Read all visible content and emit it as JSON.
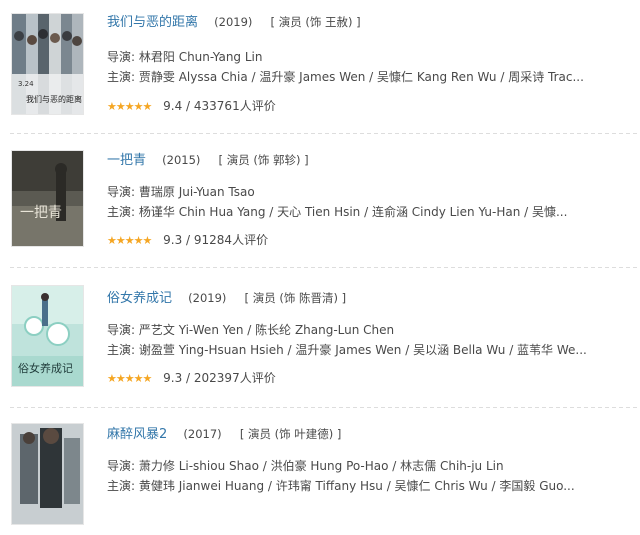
{
  "movies": [
    {
      "title": "我们与恶的距离",
      "year": "(2019)",
      "role": "[ 演员 (饰 王赦) ]",
      "director_label": "导演:",
      "director": "林君阳 Chun-Yang Lin",
      "cast_label": "主演:",
      "cast": "贾静雯 Alyssa Chia / 温升豪 James Wen / 吴慷仁 Kang Ren Wu / 周采诗 Trac...",
      "stars": "★★★★★",
      "rating": "9.4 / 433761人评价",
      "poster_icon": "movie-poster",
      "poster_text": [
        "3.24",
        "我们与恶的距离"
      ]
    },
    {
      "title": "一把青",
      "year": "(2015)",
      "role": "[ 演员 (饰 郭轸) ]",
      "director_label": "导演:",
      "director": "曹瑞原 Jui-Yuan Tsao",
      "cast_label": "主演:",
      "cast": "杨谨华 Chin Hua Yang / 天心 Tien Hsin / 连俞涵 Cindy Lien Yu-Han / 吴慷...",
      "stars": "★★★★★",
      "rating": "9.3 / 91284人评价",
      "poster_icon": "movie-poster",
      "poster_text": [
        "一把青"
      ]
    },
    {
      "title": "俗女养成记",
      "year": "(2019)",
      "role": "[ 演员 (饰 陈晋清) ]",
      "director_label": "导演:",
      "director": "严艺文 Yi-Wen Yen / 陈长纶 Zhang-Lun Chen",
      "cast_label": "主演:",
      "cast": "谢盈萱 Ying-Hsuan Hsieh / 温升豪 James Wen / 吴以涵 Bella Wu / 蓝苇华 We...",
      "stars": "★★★★★",
      "rating": "9.3 / 202397人评价",
      "poster_icon": "movie-poster",
      "poster_text": [
        "俗女养成记"
      ]
    },
    {
      "title": "麻醉风暴2",
      "year": "(2017)",
      "role": "[ 演员 (饰 叶建德) ]",
      "director_label": "导演:",
      "director": "萧力修 Li-shiou Shao / 洪伯豪 Hung Po-Hao / 林志儒 Chih-ju Lin",
      "cast_label": "主演:",
      "cast": "黄健玮 Jianwei Huang / 许玮甯 Tiffany Hsu / 吴慷仁 Chris Wu / 李国毅 Guo...",
      "stars": "",
      "rating": "",
      "poster_icon": "movie-poster",
      "poster_text": []
    }
  ],
  "colors": {
    "link": "#3377aa",
    "text": "#494949",
    "star": "#f5a623",
    "divider": "#dddddd"
  }
}
